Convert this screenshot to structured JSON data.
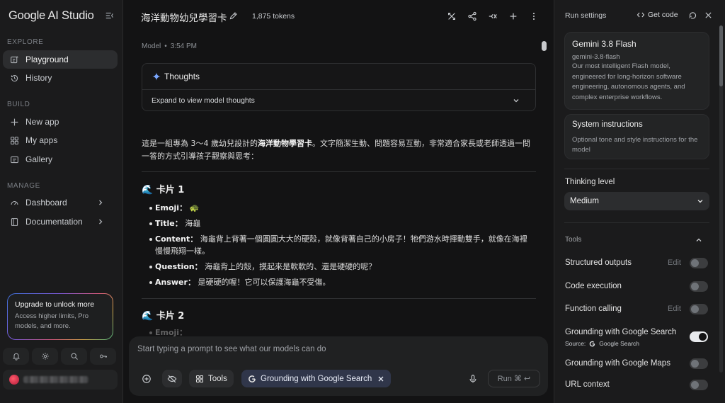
{
  "sidebar": {
    "logo": "Google AI Studio",
    "sections": {
      "explore": "EXPLORE",
      "build": "BUILD",
      "manage": "MANAGE"
    },
    "items": {
      "playground": "Playground",
      "history": "History",
      "new_app": "New app",
      "my_apps": "My apps",
      "gallery": "Gallery",
      "dashboard": "Dashboard",
      "documentation": "Documentation"
    },
    "upgrade": {
      "title": "Upgrade to unlock more",
      "text": "Access higher limits, Pro models, and more."
    }
  },
  "header": {
    "title": "海洋動物幼兒學習卡",
    "tokens": "1,875 tokens"
  },
  "chat": {
    "role": "Model",
    "time": "3:54 PM",
    "thoughts_label": "Thoughts",
    "thoughts_expand": "Expand to view model thoughts",
    "intro_pre": "這是一組專為 3～4 歲幼兒設計的",
    "intro_bold": "海洋動物學習卡",
    "intro_post": "。文字簡潔生動、問題容易互動，非常適合家長或老師透過一問一答的方式引導孩子觀察與思考：",
    "card1": {
      "title": "🌊 卡片 1",
      "emoji_label": "Emoji：",
      "emoji_value": "🐢",
      "title_label": "Title：",
      "title_value": "海龜",
      "content_label": "Content：",
      "content_value": "海龜背上背著一個圓圓大大的硬殼，就像背著自己的小房子！牠們游水時揮動雙手，就像在海裡慢慢飛翔一樣。",
      "question_label": "Question：",
      "question_value": "海龜背上的殼，摸起來是軟軟的、還是硬硬的呢？",
      "answer_label": "Answer：",
      "answer_value": "是硬硬的喔！它可以保護海龜不受傷。"
    },
    "card2": {
      "title": "🌊 卡片 2",
      "emoji_label": "Emoji："
    }
  },
  "prompt": {
    "placeholder": "Start typing a prompt to see what our models can do",
    "tools_label": "Tools",
    "grounding_label": "Grounding with Google Search",
    "run_label": "Run ⌘ ↩"
  },
  "panel": {
    "title": "Run settings",
    "get_code": "Get code",
    "model": {
      "name": "Gemini 3.8 Flash",
      "id": "gemini-3.8-flash",
      "description": "Our most intelligent Flash model, engineered for long-horizon software engineering, autonomous agents, and complex enterprise workflows."
    },
    "system": {
      "title": "System instructions",
      "description": "Optional tone and style instructions for the model"
    },
    "thinking_label": "Thinking level",
    "thinking_value": "Medium",
    "tools_header": "Tools",
    "tools": [
      {
        "label": "Structured outputs",
        "edit": "Edit",
        "on": false
      },
      {
        "label": "Code execution",
        "edit": "",
        "on": false
      },
      {
        "label": "Function calling",
        "edit": "Edit",
        "on": false
      },
      {
        "label": "Grounding with Google Search",
        "edit": "",
        "on": true
      },
      {
        "label": "Grounding with Google Maps",
        "edit": "",
        "on": false
      },
      {
        "label": "URL context",
        "edit": "",
        "on": false
      }
    ],
    "source_label": "Source:",
    "source_value": "Google Search"
  }
}
